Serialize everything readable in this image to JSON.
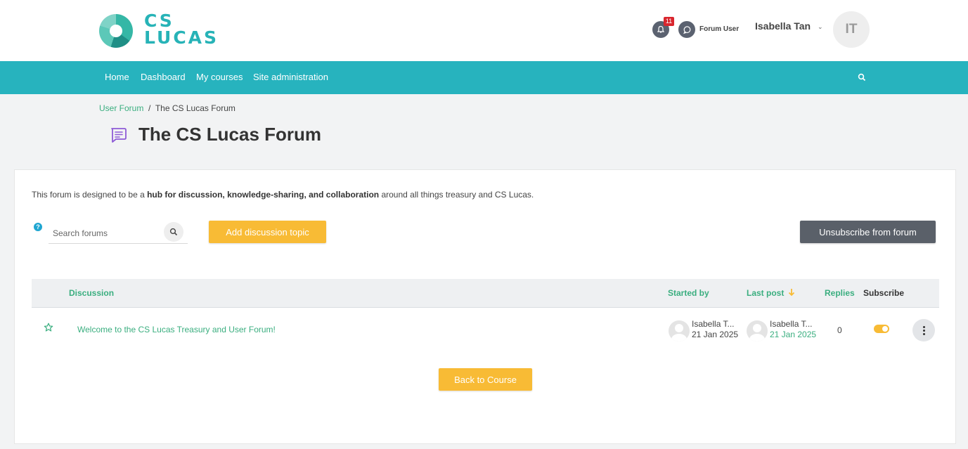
{
  "brand": {
    "line1": "CS",
    "line2": "LUCAS"
  },
  "header": {
    "notification_count": "11",
    "forum_user_label": "Forum User",
    "user_name": "Isabella Tan",
    "avatar_initials": "IT"
  },
  "nav": {
    "items": [
      "Home",
      "Dashboard",
      "My courses",
      "Site administration"
    ]
  },
  "breadcrumb": {
    "parent": "User Forum",
    "separator": "/",
    "current": "The CS Lucas Forum"
  },
  "page_title": "The CS Lucas Forum",
  "intro": {
    "before": "This forum is designed to be a ",
    "bold": "hub for discussion, knowledge-sharing, and collaboration",
    "after": " around all things treasury and CS Lucas."
  },
  "search": {
    "placeholder": "Search forums",
    "help": "?"
  },
  "buttons": {
    "add_topic": "Add discussion topic",
    "unsubscribe": "Unsubscribe from forum",
    "back": "Back to Course"
  },
  "table": {
    "headers": {
      "discussion": "Discussion",
      "started_by": "Started by",
      "last_post": "Last post",
      "replies": "Replies",
      "subscribe": "Subscribe"
    },
    "rows": [
      {
        "title": "Welcome to the CS Lucas Treasury and User Forum!",
        "started_by_name": "Isabella T...",
        "started_by_date": "21 Jan 2025",
        "last_post_name": "Isabella T...",
        "last_post_date": "21 Jan 2025",
        "replies": "0",
        "subscribed": true
      }
    ]
  },
  "colors": {
    "accent": "#27b3be",
    "link_green": "#3aae7f",
    "button_yellow": "#f8bb35",
    "button_dark": "#5a6069",
    "badge_red": "#d9262e"
  },
  "icons": [
    "bell-icon",
    "chat-icon",
    "chevron-down-icon",
    "search-icon",
    "forum-icon",
    "help-icon",
    "star-icon",
    "arrow-down-icon",
    "kebab-icon"
  ]
}
